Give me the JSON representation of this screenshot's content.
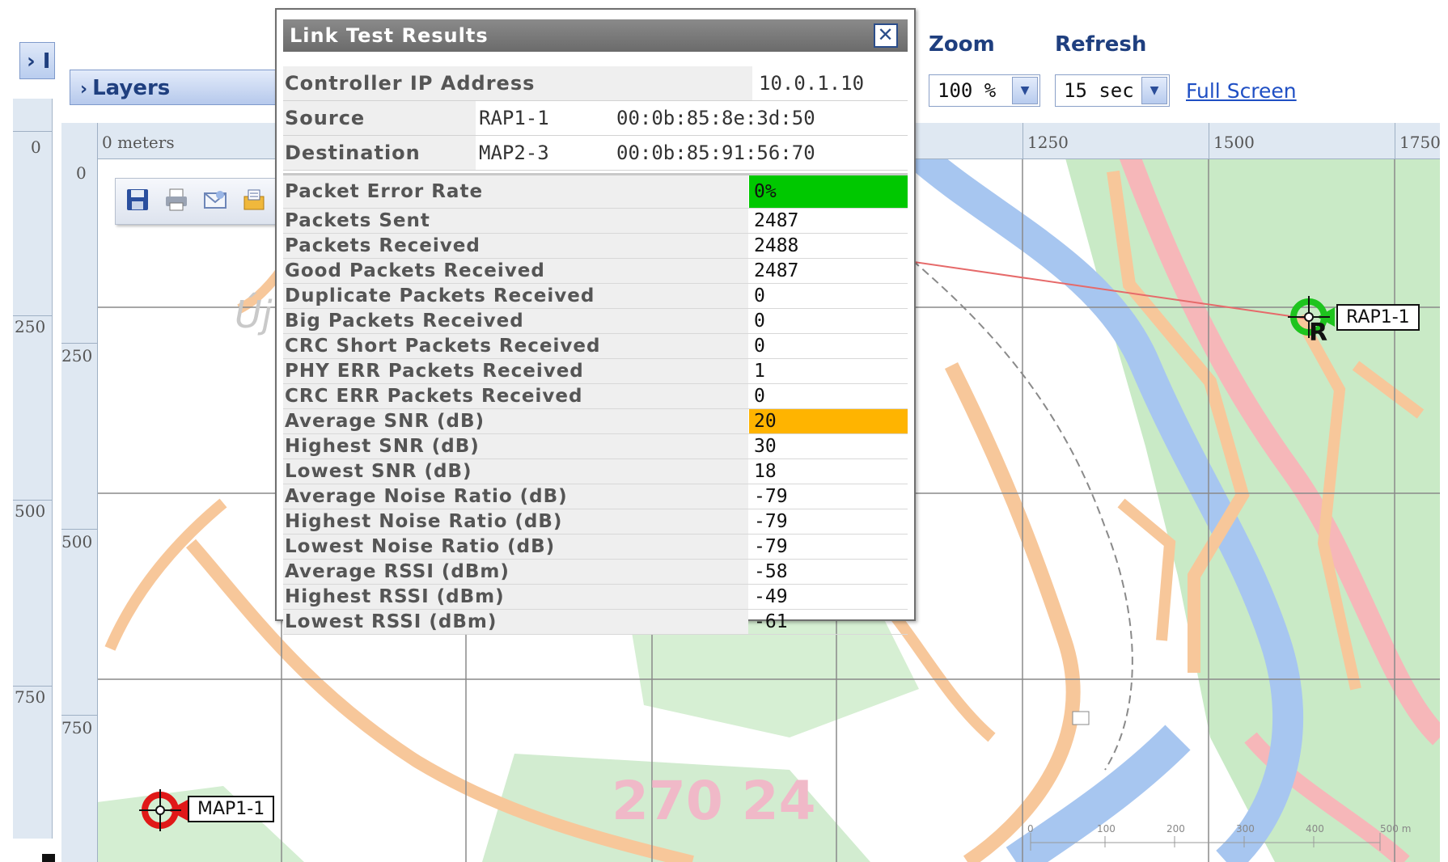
{
  "left_panel": {
    "mini_tab_label": "› I",
    "layers_label": "Layers"
  },
  "controls": {
    "zoom_label": "Zoom",
    "zoom_value": "100 %",
    "refresh_label": "Refresh",
    "refresh_value": "15 sec",
    "full_screen_link": "Full Screen"
  },
  "map": {
    "ruler_top_labels": [
      "0 meters",
      "1250",
      "1500",
      "1750"
    ],
    "ruler_left_outer": [
      "0",
      "250",
      "500",
      "750"
    ],
    "ruler_left_inner": [
      "0",
      "250",
      "500",
      "750"
    ],
    "map_watermark": "270 24",
    "map_text_fragment": "Új",
    "scale_ticks": [
      "0",
      "100",
      "200",
      "300",
      "400",
      "500 m"
    ],
    "aps": [
      {
        "label": "RAP1-1",
        "status": "green"
      },
      {
        "label": "MAP1-1",
        "status": "red"
      }
    ],
    "rap_letter": "R",
    "toolbar_icons": [
      "save-icon",
      "print-icon",
      "email-icon",
      "export-icon"
    ]
  },
  "dialog": {
    "title": "Link Test Results",
    "controller": {
      "label": "Controller IP Address",
      "value": "10.0.1.10"
    },
    "source": {
      "label": "Source",
      "name": "RAP1-1",
      "mac": "00:0b:85:8e:3d:50"
    },
    "destination": {
      "label": "Destination",
      "name": "MAP2-3",
      "mac": "00:0b:85:91:56:70"
    },
    "stats": [
      {
        "label": "Packet Error Rate",
        "value": "0%",
        "highlight": "#00c800"
      },
      {
        "label": "Packets Sent",
        "value": "2487"
      },
      {
        "label": "Packets Received",
        "value": "2488"
      },
      {
        "label": "Good Packets Received",
        "value": "2487"
      },
      {
        "label": "Duplicate Packets Received",
        "value": "0"
      },
      {
        "label": "Big Packets Received",
        "value": "0"
      },
      {
        "label": "CRC Short Packets Received",
        "value": "0"
      },
      {
        "label": "PHY ERR Packets Received",
        "value": "1"
      },
      {
        "label": "CRC ERR Packets Received",
        "value": "0"
      },
      {
        "label": "Average SNR (dB)",
        "value": "20",
        "highlight": "#ffb400"
      },
      {
        "label": "Highest SNR (dB)",
        "value": "30"
      },
      {
        "label": "Lowest SNR (dB)",
        "value": "18"
      },
      {
        "label": "Average Noise Ratio (dB)",
        "value": "-79"
      },
      {
        "label": "Highest Noise Ratio (dB)",
        "value": "-79"
      },
      {
        "label": "Lowest Noise Ratio (dB)",
        "value": "-79"
      },
      {
        "label": "Average RSSI (dBm)",
        "value": "-58"
      },
      {
        "label": "Highest RSSI (dBm)",
        "value": "-49"
      },
      {
        "label": "Lowest RSSI (dBm)",
        "value": "-61"
      }
    ]
  },
  "colors": {
    "river": "#a7c6f0",
    "road": "#f7c79a",
    "forest": "#c9eac6",
    "pink_road": "#f6b7b9",
    "grid": "#8a8a8a",
    "link_line": "#e66a6a"
  }
}
